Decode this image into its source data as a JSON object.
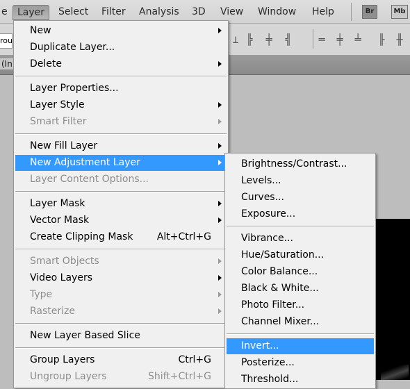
{
  "menubar": {
    "items": [
      {
        "label": "e"
      },
      {
        "label": "Layer",
        "active": true
      },
      {
        "label": "Select"
      },
      {
        "label": "Filter"
      },
      {
        "label": "Analysis"
      },
      {
        "label": "3D"
      },
      {
        "label": "View"
      },
      {
        "label": "Window"
      },
      {
        "label": "Help"
      }
    ],
    "bridge_badge": "Br",
    "minibridge_badge": "Mb"
  },
  "options_bar": {
    "left_input_value": "rou",
    "align_icons": [
      "align-bottom-edges-icon",
      "align-left-edges-icon",
      "align-horizontal-centers-icon",
      "align-right-edges-icon",
      "distribute-top-edges-icon",
      "distribute-vertical-centers-icon",
      "distribute-bottom-edges-icon",
      "distribute-left-edges-icon",
      "distribute-horizontal-centers-icon"
    ]
  },
  "document_tab": {
    "label": "(In"
  },
  "layer_menu": {
    "items": [
      {
        "label": "New",
        "submenu": true
      },
      {
        "label": "Duplicate Layer..."
      },
      {
        "label": "Delete",
        "submenu": true
      },
      {
        "divider": true
      },
      {
        "label": "Layer Properties..."
      },
      {
        "label": "Layer Style",
        "submenu": true
      },
      {
        "label": "Smart Filter",
        "submenu": true,
        "disabled": true
      },
      {
        "divider": true
      },
      {
        "label": "New Fill Layer",
        "submenu": true
      },
      {
        "label": "New Adjustment Layer",
        "submenu": true,
        "highlighted": true
      },
      {
        "label": "Layer Content Options...",
        "disabled": true
      },
      {
        "divider": true
      },
      {
        "label": "Layer Mask",
        "submenu": true
      },
      {
        "label": "Vector Mask",
        "submenu": true
      },
      {
        "label": "Create Clipping Mask",
        "shortcut": "Alt+Ctrl+G"
      },
      {
        "divider": true
      },
      {
        "label": "Smart Objects",
        "submenu": true,
        "disabled": true
      },
      {
        "label": "Video Layers",
        "submenu": true
      },
      {
        "label": "Type",
        "submenu": true,
        "disabled": true
      },
      {
        "label": "Rasterize",
        "submenu": true,
        "disabled": true
      },
      {
        "divider": true
      },
      {
        "label": "New Layer Based Slice"
      },
      {
        "divider": true
      },
      {
        "label": "Group Layers",
        "shortcut": "Ctrl+G"
      },
      {
        "label": "Ungroup Layers",
        "shortcut": "Shift+Ctrl+G",
        "disabled": true
      }
    ]
  },
  "adjustment_submenu": {
    "items": [
      {
        "label": "Brightness/Contrast..."
      },
      {
        "label": "Levels..."
      },
      {
        "label": "Curves..."
      },
      {
        "label": "Exposure..."
      },
      {
        "divider": true
      },
      {
        "label": "Vibrance..."
      },
      {
        "label": "Hue/Saturation..."
      },
      {
        "label": "Color Balance..."
      },
      {
        "label": "Black & White..."
      },
      {
        "label": "Photo Filter..."
      },
      {
        "label": "Channel Mixer..."
      },
      {
        "divider": true
      },
      {
        "label": "Invert...",
        "highlighted": true
      },
      {
        "label": "Posterize..."
      },
      {
        "label": "Threshold..."
      }
    ]
  },
  "colors": {
    "highlight": "#3399ff",
    "menu_bg": "#f0f0f0",
    "disabled_text": "#8d8d8d"
  }
}
